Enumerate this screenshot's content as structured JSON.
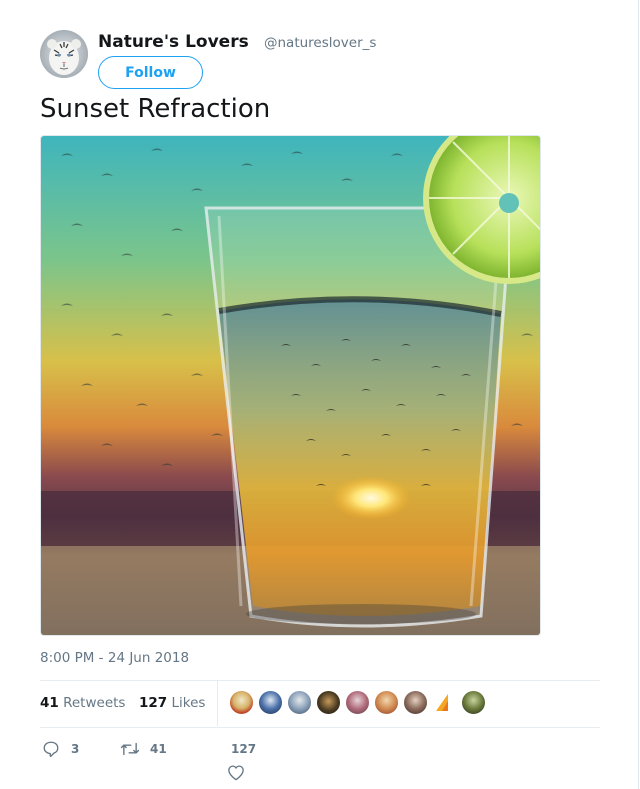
{
  "tweet": {
    "display_name": "Nature's Lovers",
    "handle": "@natureslover_s",
    "follow_label": "Follow",
    "text": "Sunset Refraction",
    "timestamp": "8:00 PM - 24 Jun 2018"
  },
  "stats": {
    "retweets_count": "41",
    "retweets_label": "Retweets",
    "likes_count": "127",
    "likes_label": "Likes"
  },
  "actions": {
    "reply_count": "3",
    "retweet_count": "41",
    "like_count": "127"
  },
  "icons": {
    "reply": "reply-icon",
    "retweet": "retweet-icon",
    "like": "heart-icon"
  },
  "colors": {
    "accent": "#1da1f2",
    "secondary_text": "#657786",
    "primary_text": "#14171a",
    "divider": "#e6ecf0"
  }
}
